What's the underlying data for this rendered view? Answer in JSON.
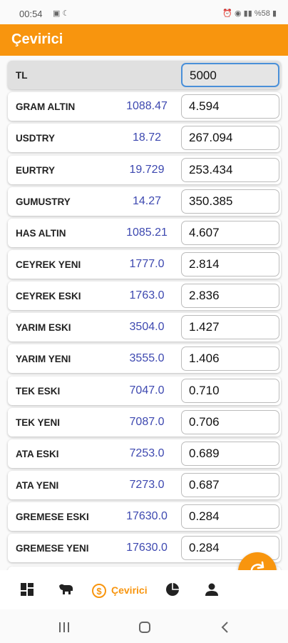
{
  "status": {
    "time": "00:54",
    "battery": "%58"
  },
  "appbar": {
    "title": "Çevirici"
  },
  "base": {
    "label": "TL",
    "value": "5000"
  },
  "rows": [
    {
      "label": "GRAM ALTIN",
      "rate": "1088.47",
      "value": "4.594"
    },
    {
      "label": "USDTRY",
      "rate": "18.72",
      "value": "267.094"
    },
    {
      "label": "EURTRY",
      "rate": "19.729",
      "value": "253.434"
    },
    {
      "label": "GUMUSTRY",
      "rate": "14.27",
      "value": "350.385"
    },
    {
      "label": "HAS ALTIN",
      "rate": "1085.21",
      "value": "4.607"
    },
    {
      "label": "CEYREK YENI",
      "rate": "1777.0",
      "value": "2.814"
    },
    {
      "label": "CEYREK ESKI",
      "rate": "1763.0",
      "value": "2.836"
    },
    {
      "label": "YARIM ESKI",
      "rate": "3504.0",
      "value": "1.427"
    },
    {
      "label": "YARIM YENI",
      "rate": "3555.0",
      "value": "1.406"
    },
    {
      "label": "TEK ESKI",
      "rate": "7047.0",
      "value": "0.710"
    },
    {
      "label": "TEK YENI",
      "rate": "7087.0",
      "value": "0.706"
    },
    {
      "label": "ATA ESKI",
      "rate": "7253.0",
      "value": "0.689"
    },
    {
      "label": "ATA YENI",
      "rate": "7273.0",
      "value": "0.687"
    },
    {
      "label": "GREMESE ESKI",
      "rate": "17630.0",
      "value": "0.284"
    },
    {
      "label": "GREMESE YENI",
      "rate": "17630.0",
      "value": "0.284"
    }
  ],
  "nav": {
    "active_label": "Çevirici"
  },
  "colors": {
    "accent": "#f8950e",
    "rate_text": "#3d48b0"
  }
}
